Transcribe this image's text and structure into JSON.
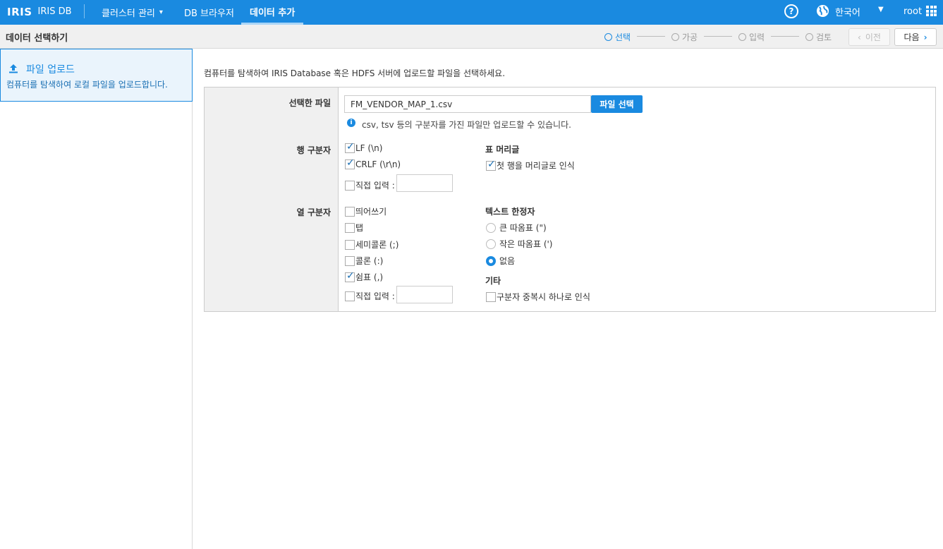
{
  "topbar": {
    "logo": "IRIS",
    "product": "IRIS DB",
    "nav": [
      {
        "label": "클러스터 관리",
        "has_dropdown": true
      },
      {
        "label": "DB 브라우저"
      },
      {
        "label": "데이터 추가",
        "active": true
      }
    ],
    "help_icon": "?",
    "language": "한국어",
    "user": "root",
    "accent_color": "#1a8ae0"
  },
  "subbar": {
    "title": "데이터 선택하기",
    "steps": [
      {
        "label": "선택",
        "active": true
      },
      {
        "label": "가공"
      },
      {
        "label": "입력"
      },
      {
        "label": "검토"
      }
    ],
    "prev_label": "이전",
    "next_label": "다음"
  },
  "sidebar": {
    "items": [
      {
        "title": "파일 업로드",
        "description": "컴퓨터를 탐색하여 로컬 파일을 업로드합니다.",
        "icon": "upload-icon"
      }
    ]
  },
  "main": {
    "intro": "컴퓨터를 탐색하여 IRIS Database 혹은 HDFS 서버에 업로드할 파일을 선택하세요.",
    "selected_file_label": "선택한 파일",
    "file_value": "FM_VENDOR_MAP_1.csv",
    "file_button": "파일 선택",
    "info": "csv, tsv 등의 구분자를 가진 파일만 업로드할 수 있습니다.",
    "row_delim_label": "행 구분자",
    "row_delims": [
      {
        "label": "LF (\\n)",
        "checked": true
      },
      {
        "label": "CRLF (\\r\\n)",
        "checked": true
      },
      {
        "label": "직접 입력 :",
        "checked": false
      }
    ],
    "table_header_label": "표 머리글",
    "table_header_option": {
      "label": "첫 행을 머리글로 인식",
      "checked": true
    },
    "col_delim_label": "열 구분자",
    "col_delims": [
      {
        "label": "띄어쓰기",
        "checked": false
      },
      {
        "label": "탭",
        "checked": false
      },
      {
        "label": "세미콜론 (;)",
        "checked": false
      },
      {
        "label": "콜론 (:)",
        "checked": false
      },
      {
        "label": "쉼표 (,)",
        "checked": true
      },
      {
        "label": "직접 입력 :",
        "checked": false
      }
    ],
    "text_qualifier_label": "텍스트 한정자",
    "text_qualifiers": [
      {
        "label": "큰 따옴표 (\")",
        "checked": false
      },
      {
        "label": "작은 따옴표 (')",
        "checked": false
      },
      {
        "label": "없음",
        "checked": true
      }
    ],
    "etc_label": "기타",
    "etc_option": {
      "label": "구분자 중복시 하나로 인식",
      "checked": false
    }
  }
}
